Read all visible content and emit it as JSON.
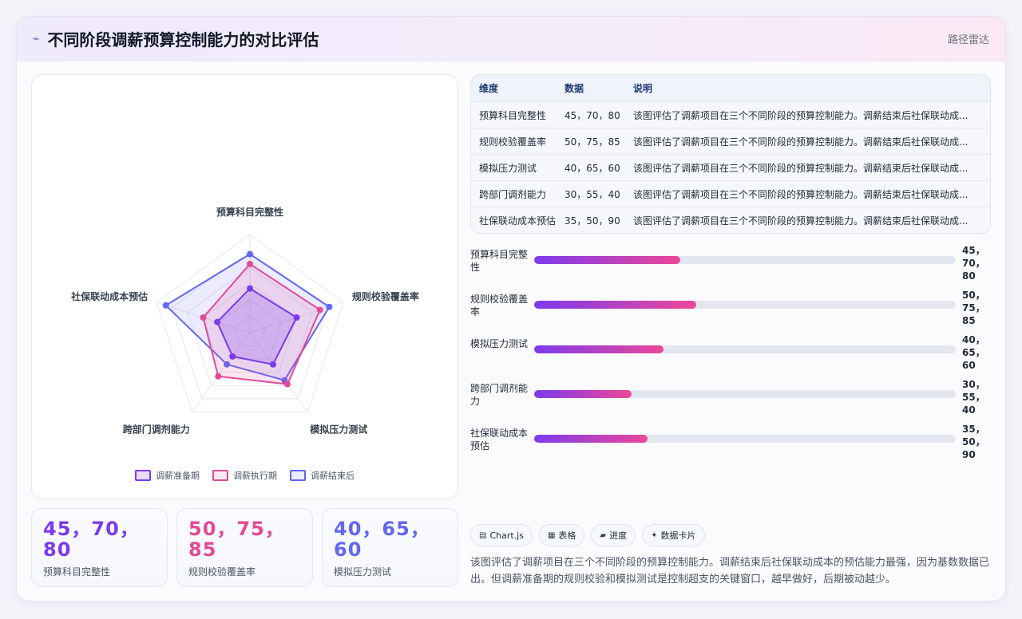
{
  "header": {
    "icon": "radar-line-icon",
    "title": "不同阶段调薪预算控制能力的对比评估",
    "tag": "路径雷达"
  },
  "colors": {
    "series": [
      "#7c3aed",
      "#e14a97",
      "#6366f1"
    ],
    "bar_gradient": [
      "#7c3aed",
      "#ec4899"
    ]
  },
  "chart_data": [
    {
      "type": "radar",
      "axes": [
        "预算科目完整性",
        "规则校验覆盖率",
        "模拟压力测试",
        "跨部门调剂能力",
        "社保联动成本预估"
      ],
      "series": [
        {
          "name": "调薪准备期",
          "values": [
            45,
            50,
            40,
            30,
            35
          ]
        },
        {
          "name": "调薪执行期",
          "values": [
            70,
            75,
            65,
            55,
            50
          ]
        },
        {
          "name": "调薪结束后",
          "values": [
            80,
            85,
            60,
            40,
            90
          ]
        }
      ],
      "range": [
        0,
        100
      ],
      "legend": "bottom"
    },
    {
      "type": "bar",
      "orientation": "horizontal",
      "categories": [
        "预算科目完整性",
        "规则校验覆盖率",
        "模拟压力测试",
        "跨部门调剂能力",
        "社保联动成本预估"
      ],
      "values": [
        45,
        50,
        40,
        30,
        35
      ],
      "value_labels": [
        "45，70，80",
        "50，75，85",
        "40，65，60",
        "30，55，40",
        "35，50，90"
      ],
      "range": [
        0,
        130
      ]
    }
  ],
  "table": {
    "headers": [
      "维度",
      "数据",
      "说明"
    ],
    "rows": [
      {
        "dim": "预算科目完整性",
        "data": "45，70，80",
        "desc": "该图评估了调薪项目在三个不同阶段的预算控制能力。调薪结束后社保联动成..."
      },
      {
        "dim": "规则校验覆盖率",
        "data": "50，75，85",
        "desc": "该图评估了调薪项目在三个不同阶段的预算控制能力。调薪结束后社保联动成..."
      },
      {
        "dim": "模拟压力测试",
        "data": "40，65，60",
        "desc": "该图评估了调薪项目在三个不同阶段的预算控制能力。调薪结束后社保联动成..."
      },
      {
        "dim": "跨部门调剂能力",
        "data": "30，55，40",
        "desc": "该图评估了调薪项目在三个不同阶段的预算控制能力。调薪结束后社保联动成..."
      },
      {
        "dim": "社保联动成本预估",
        "data": "35，50，90",
        "desc": "该图评估了调薪项目在三个不同阶段的预算控制能力。调薪结束后社保联动成..."
      }
    ]
  },
  "stats": [
    {
      "value": "45，70，80",
      "label": "预算科目完整性",
      "color": "#7c3aed"
    },
    {
      "value": "50，75，85",
      "label": "规则校验覆盖率",
      "color": "#e14a97"
    },
    {
      "value": "40，65，60",
      "label": "模拟压力测试",
      "color": "#6366f1"
    }
  ],
  "chips": [
    {
      "icon": "chart-icon",
      "glyph": "▤",
      "label": "Chart.js"
    },
    {
      "icon": "table-icon",
      "glyph": "▦",
      "label": "表格"
    },
    {
      "icon": "progress-icon",
      "glyph": "▰",
      "label": "进度"
    },
    {
      "icon": "card-icon",
      "glyph": "✦",
      "label": "数据卡片"
    }
  ],
  "summary": "该图评估了调薪项目在三个不同阶段的预算控制能力。调薪结束后社保联动成本的预估能力最强，因为基数数据已出。但调薪准备期的规则校验和模拟测试是控制超支的关键窗口，越早做好，后期被动越少。"
}
